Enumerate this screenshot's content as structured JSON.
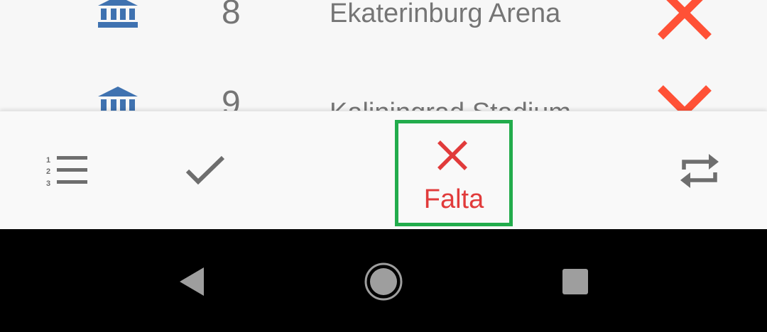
{
  "stadiums": [
    {
      "number": "8",
      "name": "Ekaterinburg Arena",
      "icon": "stadium-icon",
      "status_icon": "close-icon"
    },
    {
      "number": "9",
      "name": "Kaliningrad Stadium",
      "icon": "stadium-icon",
      "status_icon": "close-icon"
    }
  ],
  "bottom_nav": {
    "items": [
      {
        "id": "list",
        "icon": "numbered-list-icon",
        "label": ""
      },
      {
        "id": "collected",
        "icon": "check-icon",
        "label": ""
      },
      {
        "id": "missing",
        "icon": "close-icon",
        "label": "Falta",
        "selected": true
      },
      {
        "id": "swap",
        "icon": "swap-icon",
        "label": ""
      }
    ]
  },
  "system_bar": {
    "buttons": [
      "back-icon",
      "home-icon",
      "recents-icon"
    ]
  },
  "colors": {
    "stadium_icon": "#3f72b0",
    "status_red": "#ff5136",
    "selected_red": "#e13b3b",
    "gray_icon": "#6e6e6e",
    "highlight_green": "#22ac4c",
    "system_bar": "#000000"
  }
}
